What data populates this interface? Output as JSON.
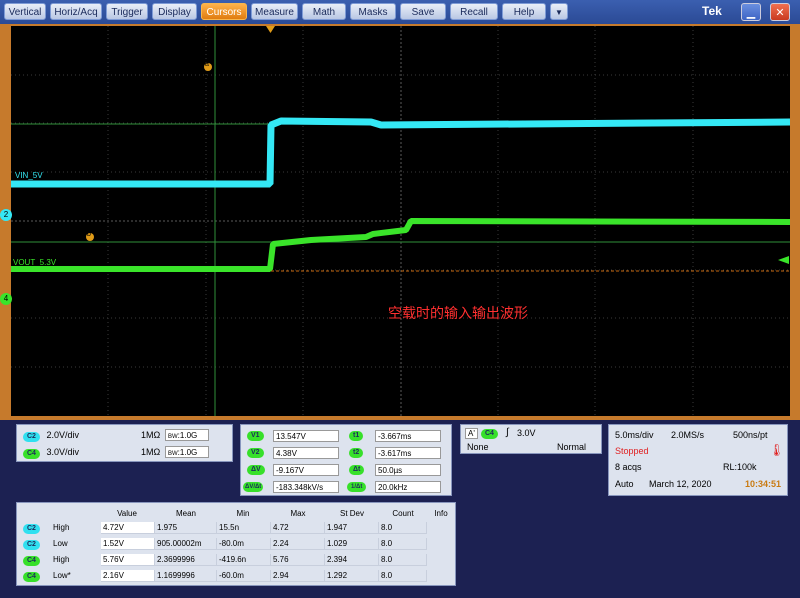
{
  "menu": {
    "items": [
      "Vertical",
      "Horiz/Acq",
      "Trigger",
      "Display",
      "Cursors",
      "Measure",
      "Math",
      "Masks",
      "Save",
      "Recall",
      "Help"
    ],
    "active": "Cursors",
    "dropdown": "▼",
    "brand": "Tek"
  },
  "scope": {
    "annotation": "空载时的输入输出波形",
    "labels": {
      "vin": "VIN_5V",
      "vout": "VOUT_5.3V",
      "cursor_a": "a",
      "cursor_b": "b",
      "ch2_marker": "2",
      "ch4_marker": "4"
    },
    "colors": {
      "ch2": "#34e8f5",
      "ch4": "#3ae42a",
      "cursor": "#e09b18",
      "grid": "#4a4a4a"
    }
  },
  "channels": [
    {
      "badge": "C2",
      "scale": "2.0V/div",
      "impedance": "1MΩ",
      "bw_label": "BW",
      "bw_value": ":1.0G"
    },
    {
      "badge": "C4",
      "scale": "3.0V/div",
      "impedance": "1MΩ",
      "bw_label": "BW",
      "bw_value": ":1.0G"
    }
  ],
  "cursors": {
    "v1": {
      "label": "V1",
      "value": "13.547V"
    },
    "v2": {
      "label": "V2",
      "value": "4.38V"
    },
    "dv": {
      "label": "ΔV",
      "value": "-9.167V"
    },
    "dvdt": {
      "label": "ΔV/Δt",
      "value": "-183.348kV/s"
    },
    "t1": {
      "label": "t1",
      "value": "-3.667ms"
    },
    "t2": {
      "label": "t2",
      "value": "-3.617ms"
    },
    "dt": {
      "label": "Δt",
      "value": "50.0µs"
    },
    "inv_dt": {
      "label": "1/Δt",
      "value": "20.0kHz"
    }
  },
  "trigger": {
    "a_badge": "A'",
    "channel": "C4",
    "slope": "∫",
    "level": "3.0V",
    "coupling": "None",
    "mode": "Normal"
  },
  "acquisition": {
    "timebase": "5.0ms/div",
    "sample_rate": "2.0MS/s",
    "resolution": "500ns/pt",
    "state": "Stopped",
    "acqs": "8 acqs",
    "record_length": "RL:100k",
    "run_mode": "Auto",
    "date": "March 12, 2020",
    "time": "10:34:51"
  },
  "measurements": {
    "headers": [
      "Value",
      "Mean",
      "Min",
      "Max",
      "St Dev",
      "Count",
      "Info"
    ],
    "rows": [
      {
        "ch": "C2",
        "name": "High",
        "value": "4.72V",
        "mean": "1.975",
        "min": "15.5n",
        "max": "4.72",
        "stdev": "1.947",
        "count": "8.0"
      },
      {
        "ch": "C2",
        "name": "Low",
        "value": "1.52V",
        "mean": "905.00002m",
        "min": "-80.0m",
        "max": "2.24",
        "stdev": "1.029",
        "count": "8.0"
      },
      {
        "ch": "C4",
        "name": "High",
        "value": "5.76V",
        "mean": "2.3699996",
        "min": "-419.6n",
        "max": "5.76",
        "stdev": "2.394",
        "count": "8.0"
      },
      {
        "ch": "C4",
        "name": "Low*",
        "value": "2.16V",
        "mean": "1.1699996",
        "min": "-60.0m",
        "max": "2.94",
        "stdev": "1.292",
        "count": "8.0"
      }
    ]
  }
}
